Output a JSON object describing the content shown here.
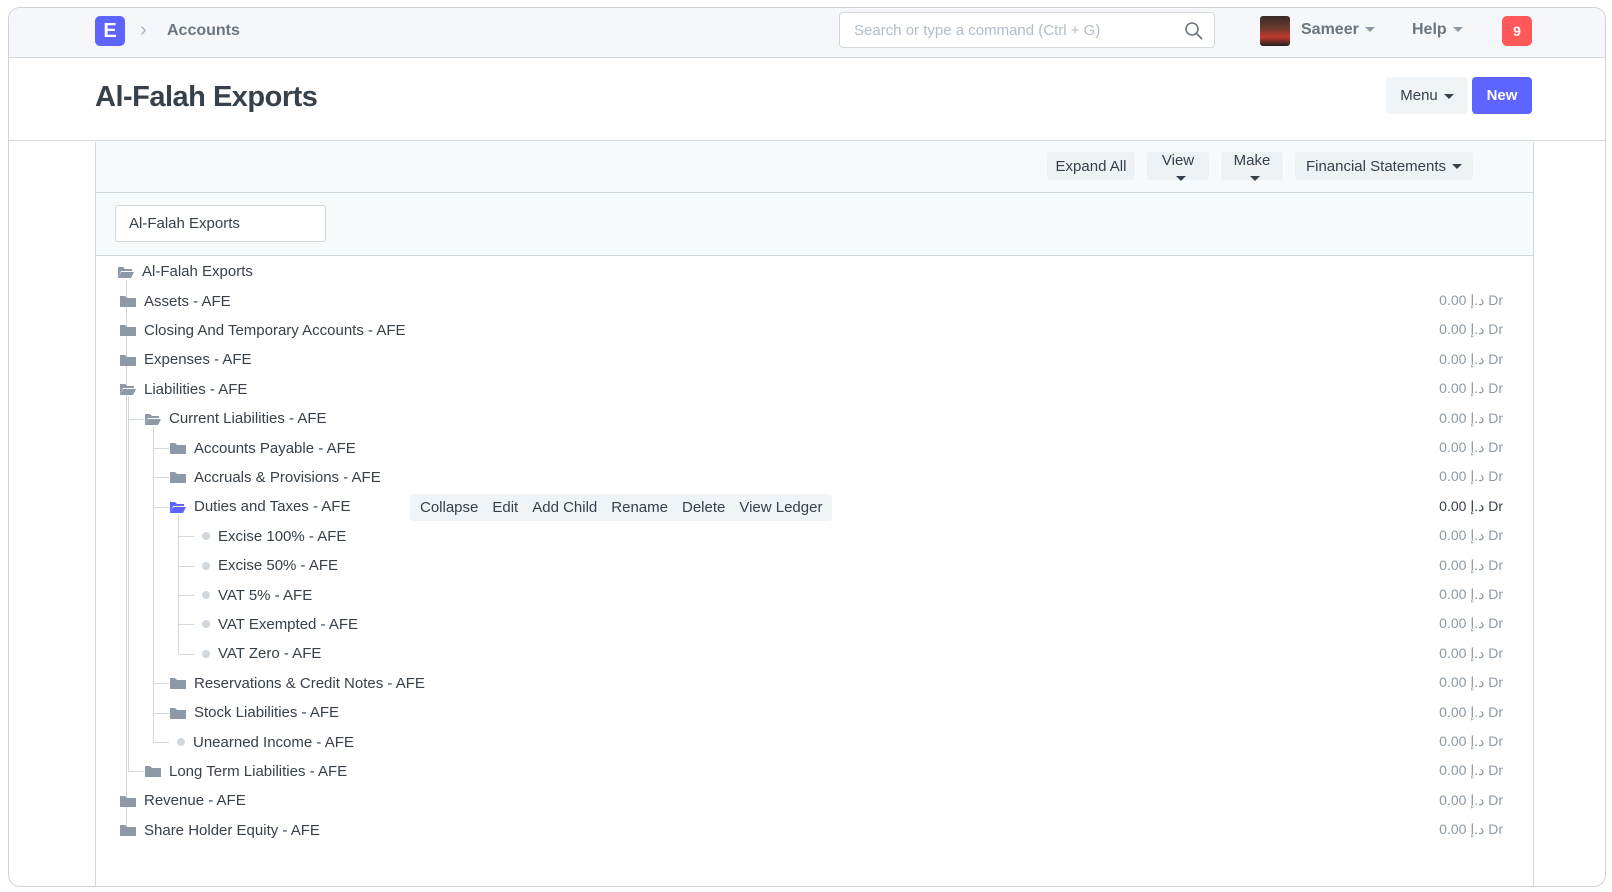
{
  "navbar": {
    "logo_letter": "E",
    "breadcrumb": "Accounts",
    "search_placeholder": "Search or type a command (Ctrl + G)",
    "user_name": "Sameer",
    "help_label": "Help",
    "notification_count": "9"
  },
  "page": {
    "title": "Al-Falah Exports",
    "menu_label": "Menu",
    "new_label": "New"
  },
  "toolbar": {
    "expand_all": "Expand All",
    "view": "View",
    "make": "Make",
    "financial_statements": "Financial Statements"
  },
  "filter": {
    "company_value": "Al-Falah Exports"
  },
  "tree": {
    "root": {
      "label": "Al-Falah Exports"
    },
    "rows": [
      {
        "label": "Assets - AFE",
        "type": "folder",
        "balance": "0.00 د.إ Dr"
      },
      {
        "label": "Closing And Temporary Accounts - AFE",
        "type": "folder",
        "balance": "0.00 د.إ Dr"
      },
      {
        "label": "Expenses - AFE",
        "type": "folder",
        "balance": "0.00 د.إ Dr"
      },
      {
        "label": "Liabilities - AFE",
        "type": "folder-open",
        "balance": "0.00 د.إ Dr"
      },
      {
        "label": "Current Liabilities - AFE",
        "type": "folder-open",
        "balance": "0.00 د.إ Dr"
      },
      {
        "label": "Accounts Payable - AFE",
        "type": "folder",
        "balance": "0.00 د.إ Dr"
      },
      {
        "label": "Accruals & Provisions - AFE",
        "type": "folder",
        "balance": "0.00 د.إ Dr"
      },
      {
        "label": "Duties and Taxes - AFE",
        "type": "folder-open-active",
        "balance": "0.00 د.إ Dr"
      },
      {
        "label": "Excise 100% - AFE",
        "type": "leaf",
        "balance": "0.00 د.إ Dr"
      },
      {
        "label": "Excise 50% - AFE",
        "type": "leaf",
        "balance": "0.00 د.إ Dr"
      },
      {
        "label": "VAT 5% - AFE",
        "type": "leaf",
        "balance": "0.00 د.إ Dr"
      },
      {
        "label": "VAT Exempted - AFE",
        "type": "leaf",
        "balance": "0.00 د.إ Dr"
      },
      {
        "label": "VAT Zero - AFE",
        "type": "leaf",
        "balance": "0.00 د.إ Dr"
      },
      {
        "label": "Reservations & Credit Notes - AFE",
        "type": "folder",
        "balance": "0.00 د.إ Dr"
      },
      {
        "label": "Stock Liabilities - AFE",
        "type": "folder",
        "balance": "0.00 د.إ Dr"
      },
      {
        "label": "Unearned Income - AFE",
        "type": "leaf",
        "balance": "0.00 د.إ Dr"
      },
      {
        "label": "Long Term Liabilities - AFE",
        "type": "folder",
        "balance": "0.00 د.إ Dr"
      },
      {
        "label": "Revenue - AFE",
        "type": "folder",
        "balance": "0.00 د.إ Dr"
      },
      {
        "label": "Share Holder Equity - AFE",
        "type": "folder",
        "balance": "0.00 د.إ Dr"
      }
    ],
    "node_actions": [
      "Collapse",
      "Edit",
      "Add Child",
      "Rename",
      "Delete",
      "View Ledger"
    ]
  },
  "colors": {
    "accent": "#5e64ff",
    "notification": "#ff5858",
    "text": "#36414c",
    "muted": "#8d99a6"
  }
}
